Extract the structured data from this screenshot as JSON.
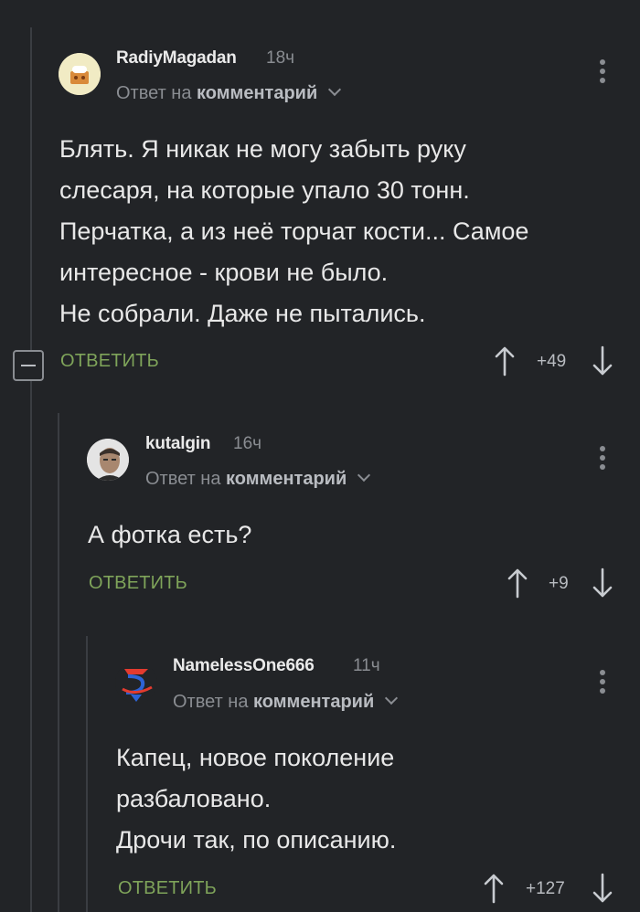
{
  "comments": [
    {
      "username": "RadiyMagadan",
      "time": "18ч",
      "reply_prefix": "Ответ на",
      "reply_target": "комментарий",
      "text": "Блять. Я никак не могу забыть руку\nслесаря, на которые упало 30 тонн.\nПерчатка, а из неё торчат кости... Самое\nинтересное - крови не было.\nНе собрали. Даже не пытались.",
      "reply_label": "ОТВЕТИТЬ",
      "rating": "+49"
    },
    {
      "username": "kutalgin",
      "time": "16ч",
      "reply_prefix": "Ответ на",
      "reply_target": "комментарий",
      "text": "А фотка есть?",
      "reply_label": "ОТВЕТИТЬ",
      "rating": "+9"
    },
    {
      "username": "NamelessOne666",
      "time": "11ч",
      "reply_prefix": "Ответ на",
      "reply_target": "комментарий",
      "text": "Капец, новое поколение\nразбаловано.\nДрочи так, по описанию.",
      "reply_label": "ОТВЕТИТЬ",
      "rating": "+127"
    }
  ],
  "icons": {
    "upvote": "arrow-up-icon",
    "downvote": "arrow-down-icon",
    "more": "more-vertical-icon",
    "collapse": "collapse-thread-icon",
    "chevron": "chevron-down-icon"
  },
  "colors": {
    "background": "#222427",
    "reply_button": "#7fa45a",
    "muted": "#8a8d92"
  }
}
